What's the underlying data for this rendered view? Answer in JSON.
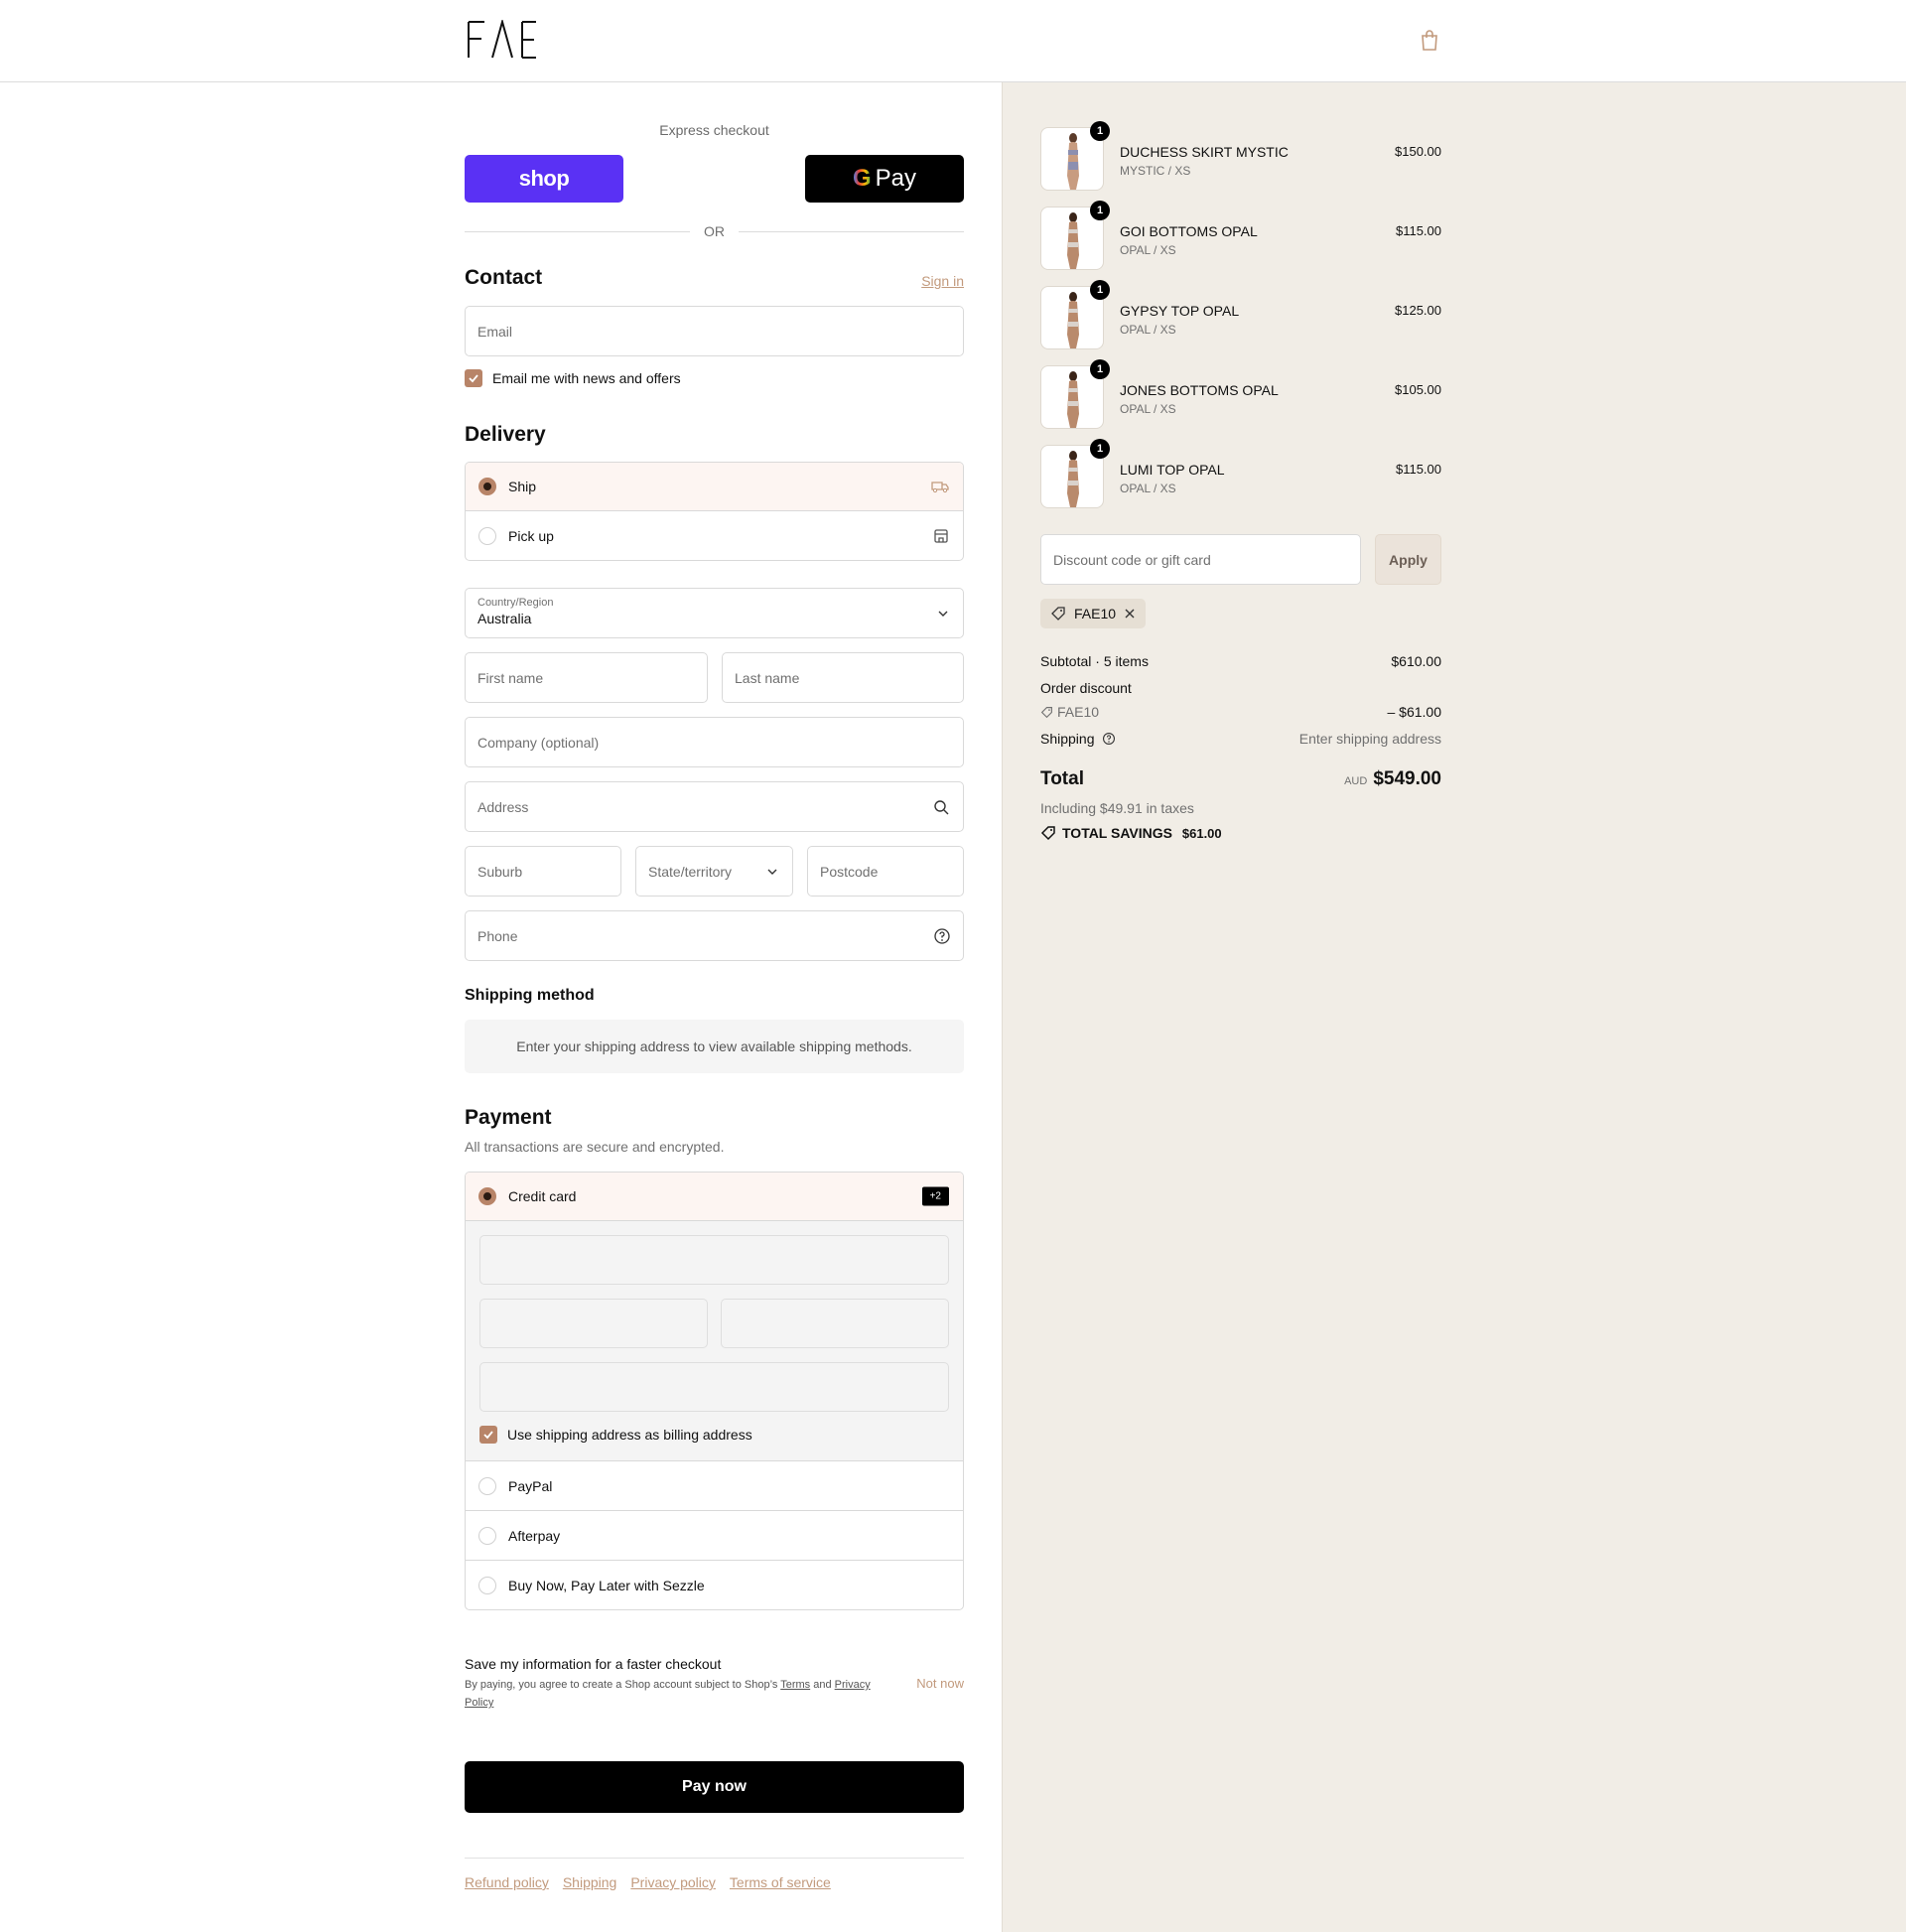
{
  "brand": {
    "logo_text": "FΛE"
  },
  "express": {
    "title": "Express checkout",
    "shop_label": "shop",
    "gpay_label": "Pay",
    "or_label": "OR"
  },
  "contact": {
    "title": "Contact",
    "sign_in": "Sign in",
    "email_placeholder": "Email",
    "news_label": "Email me with news and offers",
    "news_checked": true
  },
  "delivery": {
    "title": "Delivery",
    "options": [
      {
        "label": "Ship",
        "selected": true,
        "icon": "truck-icon"
      },
      {
        "label": "Pick up",
        "selected": false,
        "icon": "store-icon"
      }
    ],
    "country_label": "Country/Region",
    "country_value": "Australia",
    "first_name": "First name",
    "last_name": "Last name",
    "company": "Company (optional)",
    "address": "Address",
    "suburb": "Suburb",
    "state": "State/territory",
    "postcode": "Postcode",
    "phone": "Phone"
  },
  "shipping_method": {
    "title": "Shipping method",
    "note": "Enter your shipping address to view available shipping methods."
  },
  "payment": {
    "title": "Payment",
    "subtitle": "All transactions are secure and encrypted.",
    "credit_card": "Credit card",
    "more_badge": "+2",
    "billing_label": "Use shipping address as billing address",
    "billing_checked": true,
    "others": [
      "PayPal",
      "Afterpay",
      "Buy Now, Pay Later with Sezzle"
    ]
  },
  "save_info": {
    "title": "Save my information for a faster checkout",
    "line_prefix": "By paying, you agree to create a Shop account subject to Shop’s ",
    "terms": "Terms",
    "and": " and",
    "privacy": "Privacy Policy",
    "not_now": "Not now"
  },
  "pay_now": "Pay now",
  "footer": [
    "Refund policy",
    "Shipping",
    "Privacy policy",
    "Terms of service"
  ],
  "cart": {
    "items": [
      {
        "name": "DUCHESS SKIRT MYSTIC",
        "variant": "MYSTIC / XS",
        "price": "$150.00",
        "qty": "1"
      },
      {
        "name": "GOI BOTTOMS OPAL",
        "variant": "OPAL / XS",
        "price": "$115.00",
        "qty": "1"
      },
      {
        "name": "GYPSY TOP OPAL",
        "variant": "OPAL / XS",
        "price": "$125.00",
        "qty": "1"
      },
      {
        "name": "JONES BOTTOMS OPAL",
        "variant": "OPAL / XS",
        "price": "$105.00",
        "qty": "1"
      },
      {
        "name": "LUMI TOP OPAL",
        "variant": "OPAL / XS",
        "price": "$115.00",
        "qty": "1"
      }
    ],
    "discount_placeholder": "Discount code or gift card",
    "apply": "Apply",
    "applied_code": "FAE10",
    "subtotal_label": "Subtotal · 5 items",
    "subtotal_value": "$610.00",
    "order_discount_label": "Order discount",
    "discount_code": "FAE10",
    "discount_value": "– $61.00",
    "shipping_label": "Shipping",
    "shipping_value": "Enter shipping address",
    "total_label": "Total",
    "currency": "AUD",
    "total_value": "$549.00",
    "taxes": "Including $49.91 in taxes",
    "savings_label": "TOTAL SAVINGS",
    "savings_value": "$61.00"
  },
  "colors": {
    "accent": "#b88468",
    "link": "#c29a7d",
    "sidebar_bg": "#f1ede6",
    "shop_purple": "#5a31f4"
  }
}
